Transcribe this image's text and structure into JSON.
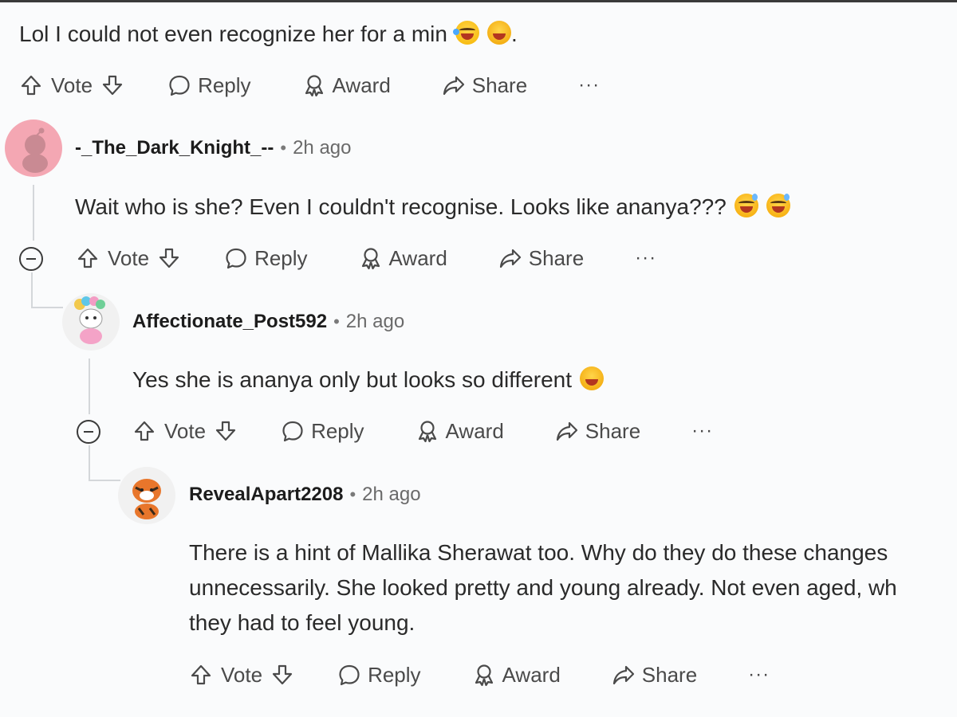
{
  "top_comment": {
    "text": "Lol I could not even recognize her for a min",
    "trailing": ".",
    "emojis": [
      "joy-emoji",
      "rofl-emoji"
    ]
  },
  "actions": {
    "vote": "Vote",
    "reply": "Reply",
    "award": "Award",
    "share": "Share",
    "more": "···"
  },
  "comments": [
    {
      "username": "-_The_Dark_Knight_--",
      "separator": "•",
      "time": "2h ago",
      "text": "Wait who is she? Even I couldn't recognise. Looks like ananya???",
      "emojis": [
        "sweat-smile-emoji",
        "sweat-smile-emoji"
      ]
    },
    {
      "username": "Affectionate_Post592",
      "separator": "•",
      "time": "2h ago",
      "text": "Yes she is ananya only but looks so different",
      "emojis": [
        "rofl-emoji"
      ]
    },
    {
      "username": "RevealApart2208",
      "separator": "•",
      "time": "2h ago",
      "lines": [
        "There is a hint of Mallika Sherawat too. Why do they do these changes",
        "unnecessarily. She looked pretty and young already. Not even aged, wh",
        "they had to feel young."
      ]
    }
  ],
  "colors": {
    "background": "#fafbfc",
    "text": "#2a2a2a",
    "meta": "#6a6a6a",
    "thread_line": "#d4d7da",
    "avatar_pink": "#f4a7b3"
  }
}
